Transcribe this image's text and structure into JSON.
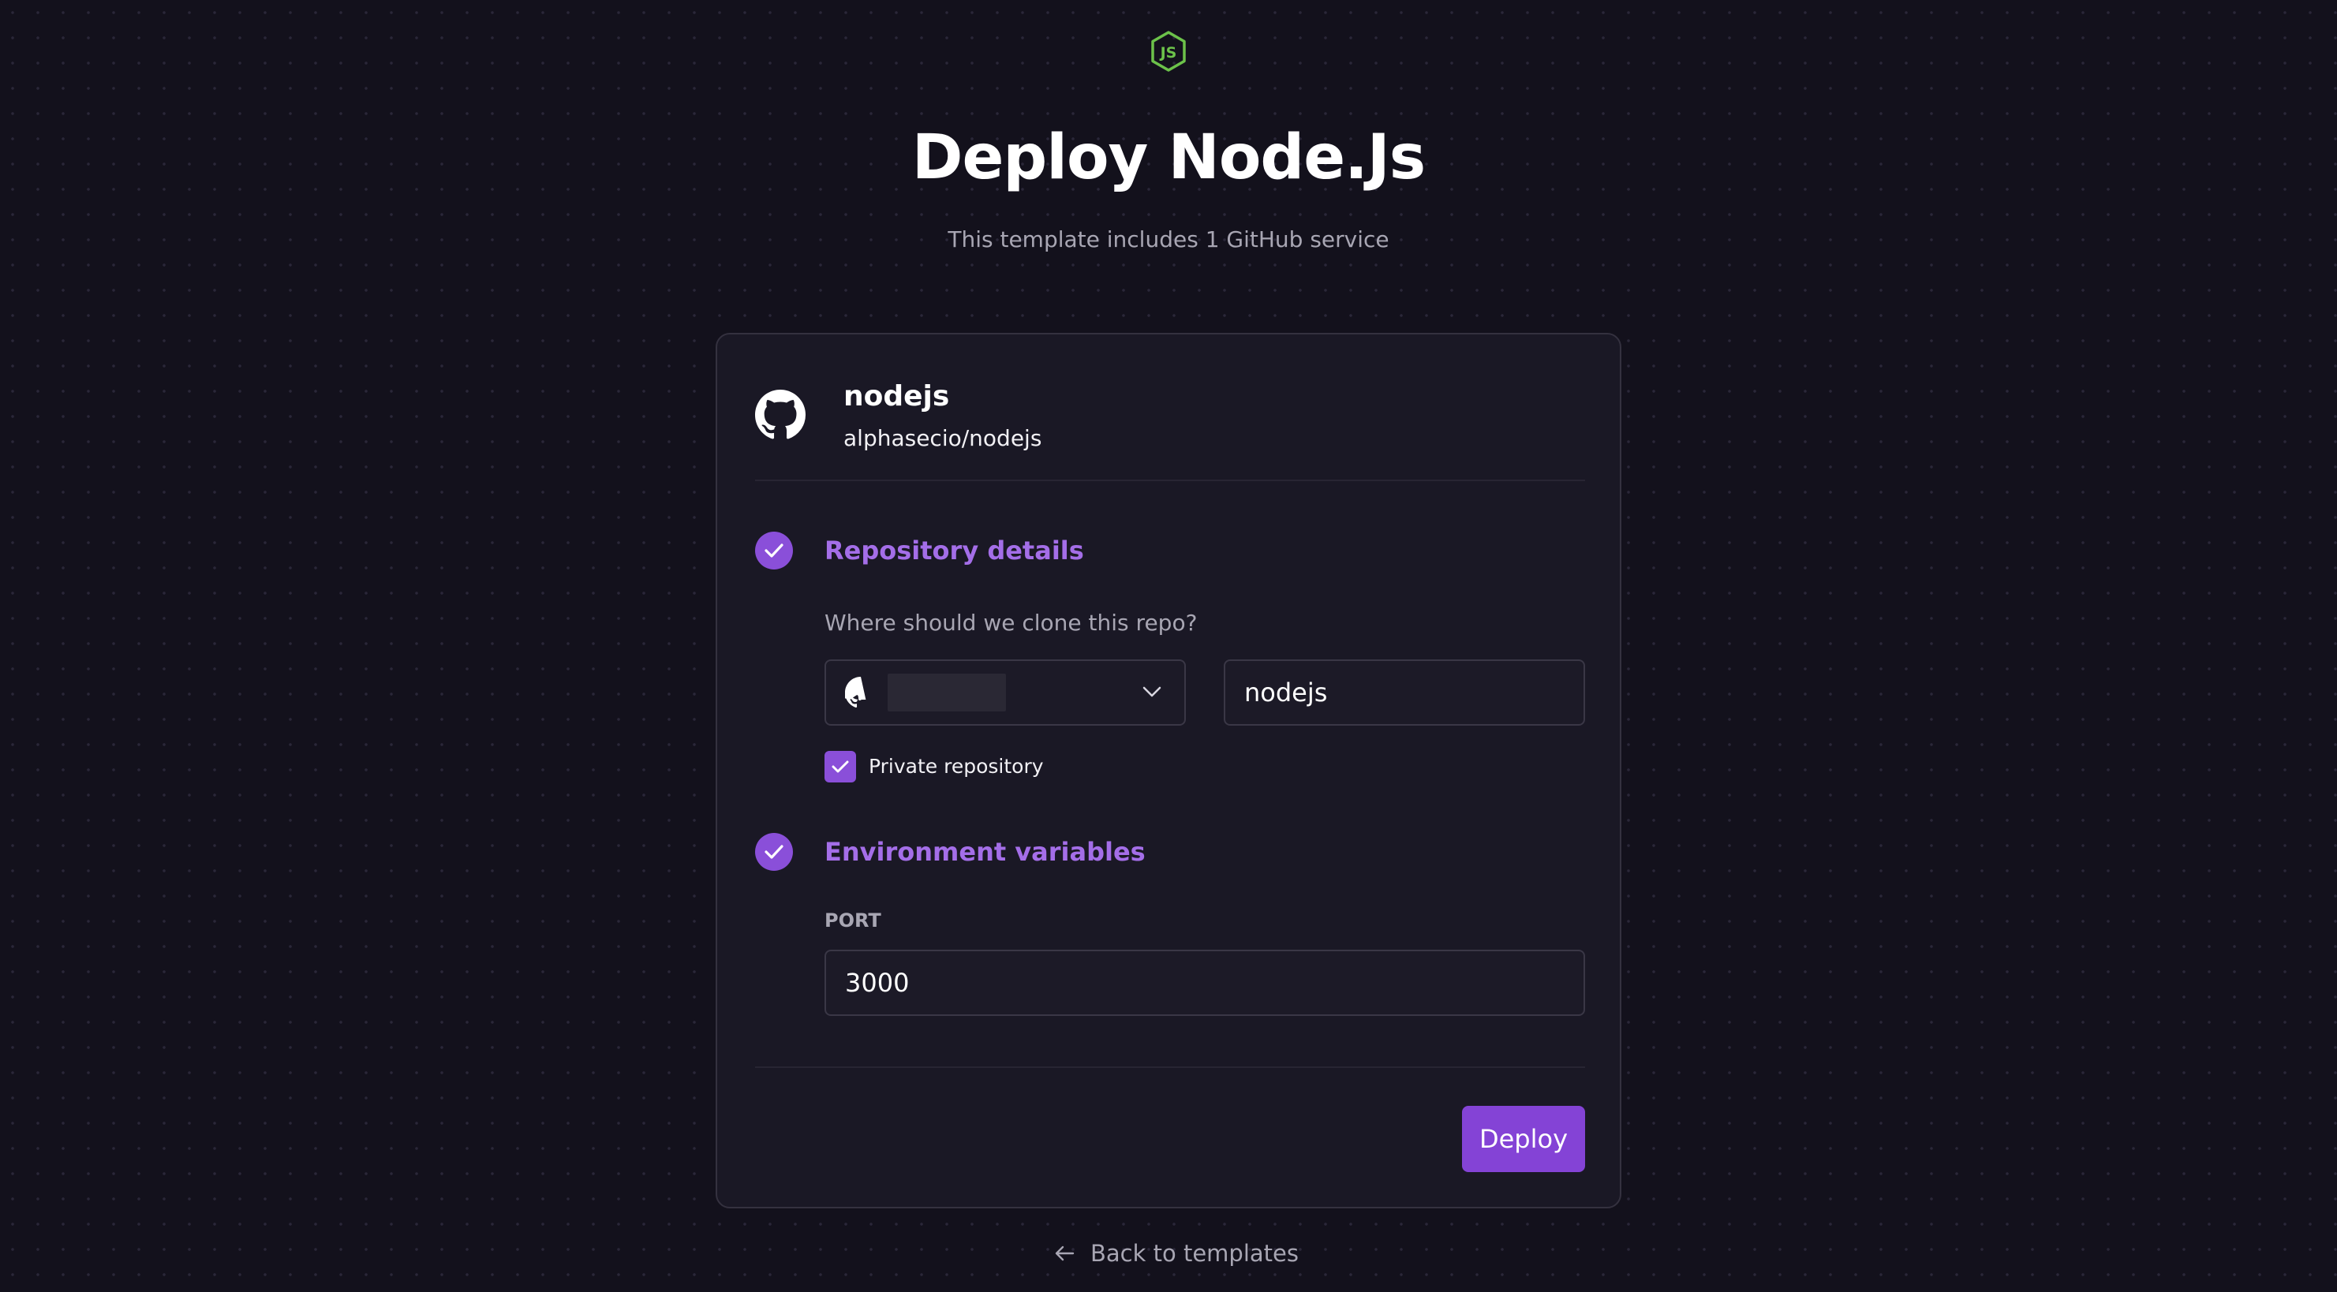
{
  "header": {
    "logo_icon": "nodejs-logo-icon",
    "title": "Deploy Node.Js",
    "subtitle": "This template includes 1 GitHub service"
  },
  "service": {
    "icon": "github-icon",
    "name": "nodejs",
    "repo": "alphasecio/nodejs"
  },
  "repository_step": {
    "title": "Repository details",
    "question": "Where should we clone this repo?",
    "repo_name_value": "nodejs",
    "private_label": "Private repository",
    "private_checked": true
  },
  "env_step": {
    "title": "Environment variables",
    "variables": [
      {
        "key": "PORT",
        "value": "3000"
      }
    ]
  },
  "actions": {
    "deploy_label": "Deploy",
    "back_label": "Back to templates"
  },
  "colors": {
    "background": "#13111c",
    "card": "#1a1825",
    "accent": "#8443d6",
    "accent_text": "#a46ee8",
    "node_green": "#6cc24a"
  }
}
